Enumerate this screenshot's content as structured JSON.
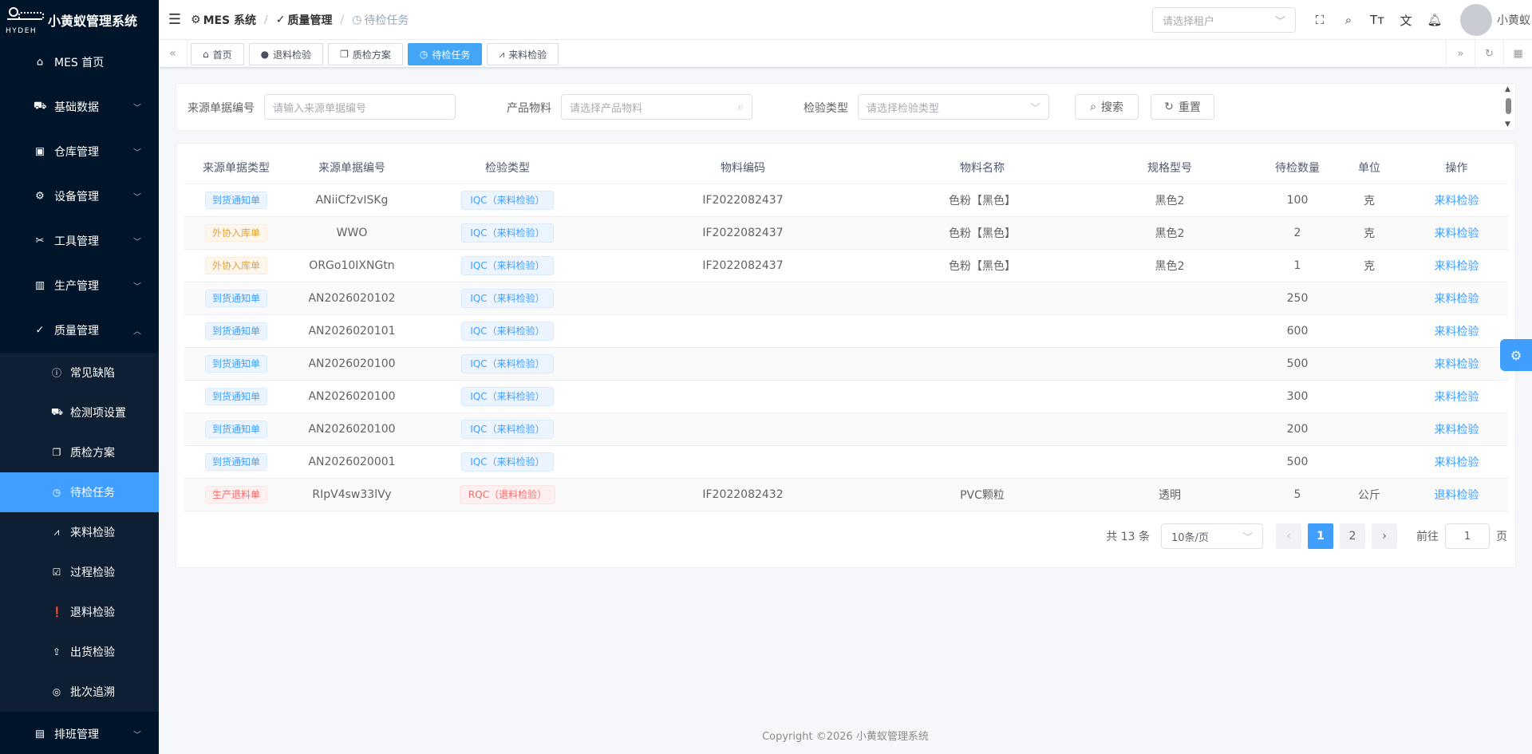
{
  "app": {
    "logo_text": "HYDEH",
    "title": "小黄蚁管理系统"
  },
  "sidebar": {
    "items": [
      {
        "label": "MES 首页",
        "icon": "home-icon",
        "expandable": false
      },
      {
        "label": "基础数据",
        "icon": "cart-icon",
        "expandable": true
      },
      {
        "label": "仓库管理",
        "icon": "warehouse-icon",
        "expandable": true
      },
      {
        "label": "设备管理",
        "icon": "gear-icon",
        "expandable": true
      },
      {
        "label": "工具管理",
        "icon": "scissors-icon",
        "expandable": true
      },
      {
        "label": "生产管理",
        "icon": "bar-chart-icon",
        "expandable": true
      },
      {
        "label": "质量管理",
        "icon": "check-icon",
        "expandable": true,
        "expanded": true
      }
    ],
    "quality_children": [
      {
        "label": "常见缺陷",
        "icon": "info-circle-icon"
      },
      {
        "label": "检测项设置",
        "icon": "cart-icon"
      },
      {
        "label": "质检方案",
        "icon": "copy-icon"
      },
      {
        "label": "待检任务",
        "icon": "clock-icon",
        "active": true
      },
      {
        "label": "来料检验",
        "icon": "chart-line-icon"
      },
      {
        "label": "过程检验",
        "icon": "clipboard-check-icon"
      },
      {
        "label": "退料检验",
        "icon": "warning-circle-icon"
      },
      {
        "label": "出货检验",
        "icon": "box-out-icon"
      },
      {
        "label": "批次追溯",
        "icon": "target-icon"
      }
    ],
    "after_items": [
      {
        "label": "排班管理",
        "icon": "calendar-icon",
        "expandable": true
      }
    ]
  },
  "navbar": {
    "breadcrumb": [
      {
        "label": "MES 系统",
        "icon": "chip-icon"
      },
      {
        "label": "质量管理",
        "icon": "check-icon"
      },
      {
        "label": "待检任务",
        "icon": "clock-icon"
      }
    ],
    "tenant_placeholder": "请选择租户",
    "username": "小黄蚁"
  },
  "tags": [
    {
      "label": "首页",
      "icon": "home-icon",
      "active": false
    },
    {
      "label": "退料检验",
      "icon": "warning-circle-icon",
      "active": false
    },
    {
      "label": "质检方案",
      "icon": "copy-icon",
      "active": false
    },
    {
      "label": "待检任务",
      "icon": "clock-icon",
      "active": true
    },
    {
      "label": "来料检验",
      "icon": "chart-line-icon",
      "active": false
    }
  ],
  "search": {
    "source_no_label": "来源单据编号",
    "source_no_placeholder": "请输入来源单据编号",
    "product_label": "产品物料",
    "product_placeholder": "请选择产品物料",
    "inspect_type_label": "检验类型",
    "inspect_type_placeholder": "请选择检验类型",
    "search_btn": "搜索",
    "reset_btn": "重置"
  },
  "table": {
    "headers": [
      "来源单据类型",
      "来源单据编号",
      "检验类型",
      "物料编码",
      "物料名称",
      "规格型号",
      "待检数量",
      "单位",
      "操作"
    ],
    "rows": [
      {
        "src_type": "到货通知单",
        "src_color": "blue",
        "src_no": "ANiiCf2vISKg",
        "inspect": "IQC（来料检验）",
        "inspect_color": "blue",
        "code": "IF2022082437",
        "name": "色粉【黑色】",
        "spec": "黑色2",
        "qty": "100",
        "unit": "克",
        "op": "来料检验"
      },
      {
        "src_type": "外协入库单",
        "src_color": "orange",
        "src_no": "WWO",
        "inspect": "IQC（来料检验）",
        "inspect_color": "blue",
        "code": "IF2022082437",
        "name": "色粉【黑色】",
        "spec": "黑色2",
        "qty": "2",
        "unit": "克",
        "op": "来料检验"
      },
      {
        "src_type": "外协入库单",
        "src_color": "orange",
        "src_no": "ORGo10IXNGtn",
        "inspect": "IQC（来料检验）",
        "inspect_color": "blue",
        "code": "IF2022082437",
        "name": "色粉【黑色】",
        "spec": "黑色2",
        "qty": "1",
        "unit": "克",
        "op": "来料检验"
      },
      {
        "src_type": "到货通知单",
        "src_color": "blue",
        "src_no": "AN2026020102",
        "inspect": "IQC（来料检验）",
        "inspect_color": "blue",
        "code": "",
        "name": "",
        "spec": "",
        "qty": "250",
        "unit": "",
        "op": "来料检验"
      },
      {
        "src_type": "到货通知单",
        "src_color": "blue",
        "src_no": "AN2026020101",
        "inspect": "IQC（来料检验）",
        "inspect_color": "blue",
        "code": "",
        "name": "",
        "spec": "",
        "qty": "600",
        "unit": "",
        "op": "来料检验"
      },
      {
        "src_type": "到货通知单",
        "src_color": "blue",
        "src_no": "AN2026020100",
        "inspect": "IQC（来料检验）",
        "inspect_color": "blue",
        "code": "",
        "name": "",
        "spec": "",
        "qty": "500",
        "unit": "",
        "op": "来料检验"
      },
      {
        "src_type": "到货通知单",
        "src_color": "blue",
        "src_no": "AN2026020100",
        "inspect": "IQC（来料检验）",
        "inspect_color": "blue",
        "code": "",
        "name": "",
        "spec": "",
        "qty": "300",
        "unit": "",
        "op": "来料检验"
      },
      {
        "src_type": "到货通知单",
        "src_color": "blue",
        "src_no": "AN2026020100",
        "inspect": "IQC（来料检验）",
        "inspect_color": "blue",
        "code": "",
        "name": "",
        "spec": "",
        "qty": "200",
        "unit": "",
        "op": "来料检验"
      },
      {
        "src_type": "到货通知单",
        "src_color": "blue",
        "src_no": "AN2026020001",
        "inspect": "IQC（来料检验）",
        "inspect_color": "blue",
        "code": "",
        "name": "",
        "spec": "",
        "qty": "500",
        "unit": "",
        "op": "来料检验"
      },
      {
        "src_type": "生产退料单",
        "src_color": "red",
        "src_no": "RIpV4sw33lVy",
        "inspect": "RQC（退料检验）",
        "inspect_color": "red",
        "code": "IF2022082432",
        "name": "PVC颗粒",
        "spec": "透明",
        "qty": "5",
        "unit": "公斤",
        "op": "退料检验"
      }
    ]
  },
  "pagination": {
    "total": "共 13 条",
    "page_size": "10条/页",
    "pages": [
      "1",
      "2"
    ],
    "current": "1",
    "goto_label": "前往",
    "goto_value": "1",
    "page_suffix": "页"
  },
  "footer": {
    "copyright": "Copyright ©2026 小黄蚁管理系统"
  },
  "colors": {
    "sidebar_bg": "#001529",
    "accent": "#409eff",
    "active_tag": "#42a5f5"
  }
}
